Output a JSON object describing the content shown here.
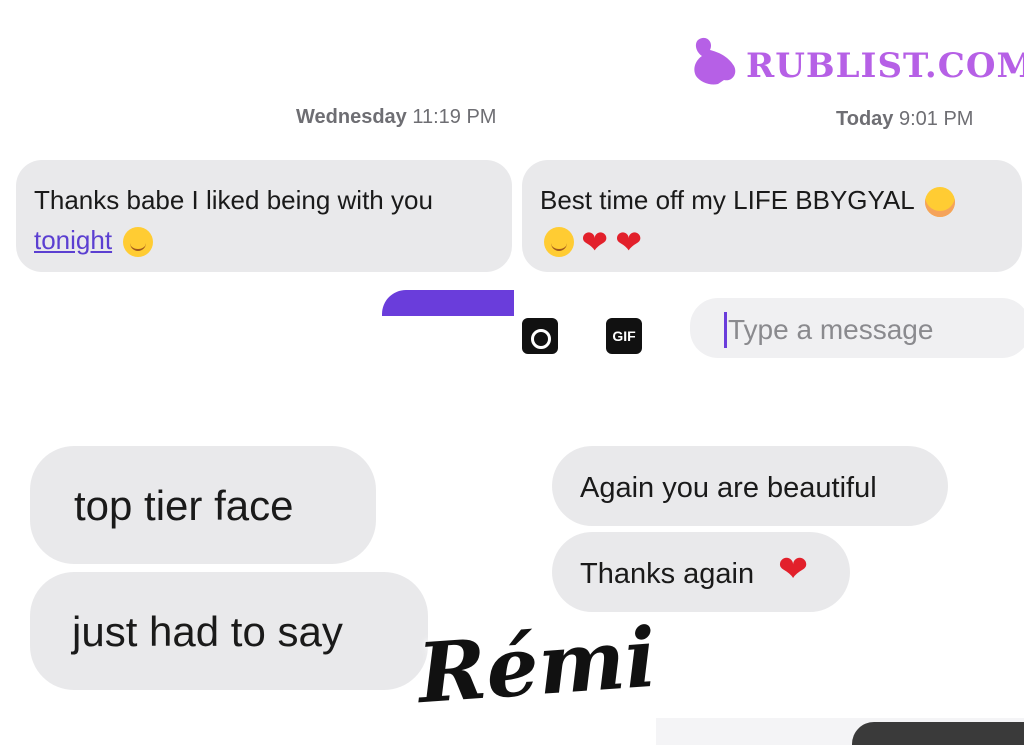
{
  "watermark": {
    "brand": "RUBLIST.COM"
  },
  "top_left_chat": {
    "timestamp_day": "Wednesday",
    "timestamp_time": "11:19 PM",
    "message_text": "Thanks babe I liked being with you",
    "message_link": "tonight"
  },
  "top_right_chat": {
    "timestamp_day": "Today",
    "timestamp_time": "9:01 PM",
    "message_text": "Best time off my LIFE BBYGYAL",
    "composer": {
      "placeholder": "Type a message",
      "gif_label": "GIF"
    }
  },
  "bottom_left_chat": {
    "messages": [
      "top tier face",
      "just had to say"
    ]
  },
  "bottom_right_chat": {
    "messages": [
      "Again you are beautiful",
      "Thanks again"
    ]
  },
  "signature": {
    "name": "Rémi"
  },
  "colors": {
    "bubble": "#e9e9eb",
    "accent": "#6a3ddb",
    "link": "#5b3fd1",
    "heart": "#e2202b",
    "brand": "#b660e6"
  },
  "icons": [
    "camera-icon",
    "gif-icon",
    "smile-emoji-icon",
    "heart-emoji-icon",
    "blush-emoji-icon"
  ]
}
